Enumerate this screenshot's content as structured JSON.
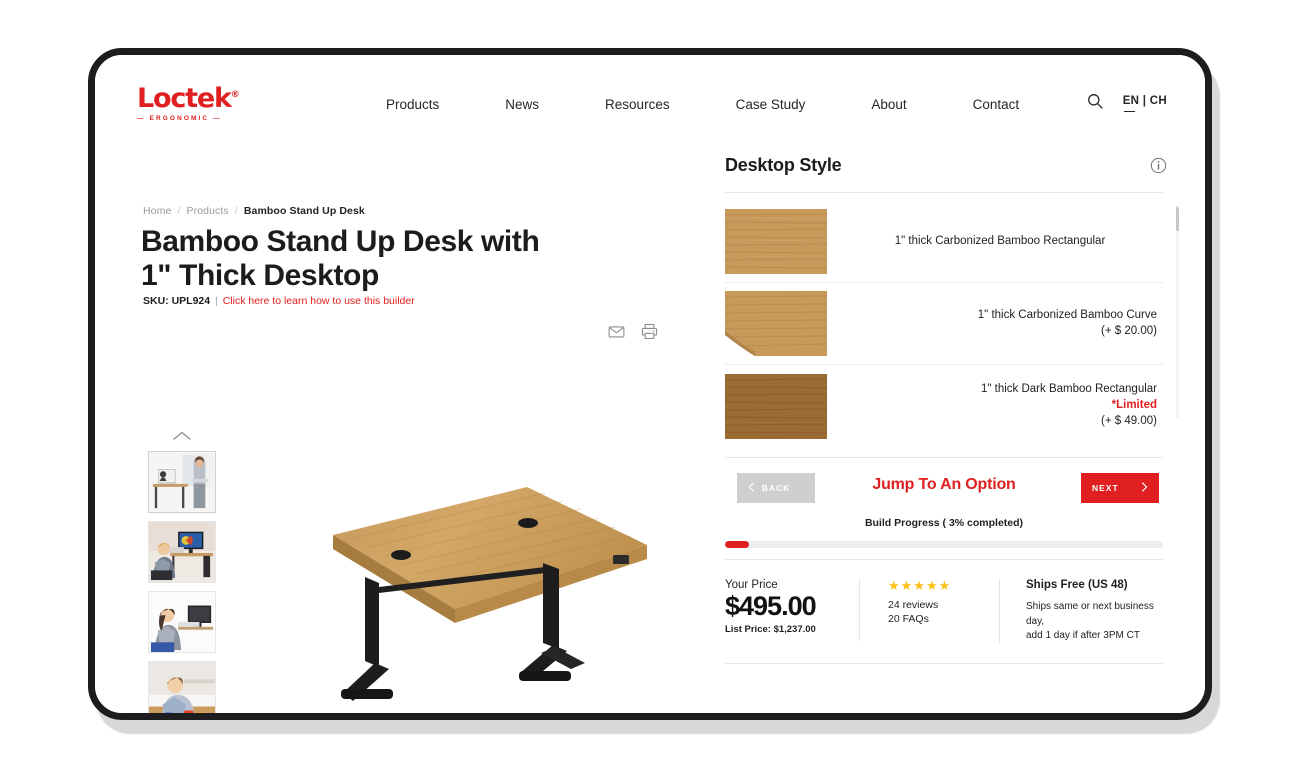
{
  "brand": {
    "name": "Loctek",
    "registered": "®",
    "tagline": "— ERGONOMIC —",
    "color": "#e02020"
  },
  "header": {
    "nav": [
      {
        "label": "Products"
      },
      {
        "label": "News"
      },
      {
        "label": "Resources"
      },
      {
        "label": "Case Study"
      },
      {
        "label": "About"
      },
      {
        "label": "Contact"
      }
    ],
    "search_icon": "search-icon",
    "language": "EN | CH"
  },
  "breadcrumb": {
    "items": [
      "Home",
      "Products"
    ],
    "current": "Bamboo Stand Up Desk",
    "separator": "/"
  },
  "product": {
    "title": "Bamboo Stand Up Desk with 1\" Thick Desktop",
    "sku_label": "SKU:",
    "sku_value": "UPL924",
    "divider": "|",
    "builder_link": "Click here to learn how to use this builder",
    "actions": [
      {
        "icon": "email-icon",
        "name": "share-by-email"
      },
      {
        "icon": "print-icon",
        "name": "print-page"
      }
    ],
    "thumbnails": [
      {
        "alt": "woman standing at desk with laptop"
      },
      {
        "alt": "woman seated at desk with dual monitor"
      },
      {
        "alt": "woman typing at standing desk converter"
      },
      {
        "alt": "woman crafting at desk"
      }
    ],
    "thumb_up_icon": "chevron-up-icon",
    "thumb_down_icon": "chevron-down-icon",
    "hero_alt": "bamboo standing desk with black legs"
  },
  "configurator": {
    "step_title": "Desktop Style",
    "info_icon": "info-icon",
    "options": [
      {
        "name": "1\" thick Carbonized Bamboo Rectangular",
        "limited": "",
        "price_delta": "",
        "align": "center",
        "swatch": "carbonized-bamboo-rectangular"
      },
      {
        "name": "1\" thick Carbonized Bamboo Curve",
        "limited": "",
        "price_delta": "(+ $ 20.00)",
        "align": "right",
        "swatch": "carbonized-bamboo-curve"
      },
      {
        "name": "1\" thick Dark Bamboo Rectangular",
        "limited": "*Limited",
        "price_delta": "(+ $ 49.00)",
        "align": "right",
        "swatch": "dark-bamboo-rectangular"
      }
    ],
    "back_label": "BACK",
    "back_icon": "chevron-left-icon",
    "next_label": "NEXT",
    "next_icon": "chevron-right-icon",
    "jump_label": "Jump To An Option",
    "progress_label": "Build Progress  ( 3% completed)",
    "progress_percent": 3
  },
  "pricing": {
    "your_price_label": "Your Price",
    "price": "$495.00",
    "list_price": "List Price: $1,237.00",
    "stars": "★★★★★",
    "star_count": 5,
    "reviews": "24 reviews",
    "faqs": "20 FAQs",
    "ship_title": "Ships Free (US 48)",
    "ship_note_line1": "Ships same or next business day,",
    "ship_note_line2": "add 1 day if after 3PM CT"
  },
  "colors": {
    "accent_red": "#e02020",
    "star_gold": "#fbbf16",
    "text_dark": "#1c1c1c",
    "muted": "#9b9b9b"
  }
}
